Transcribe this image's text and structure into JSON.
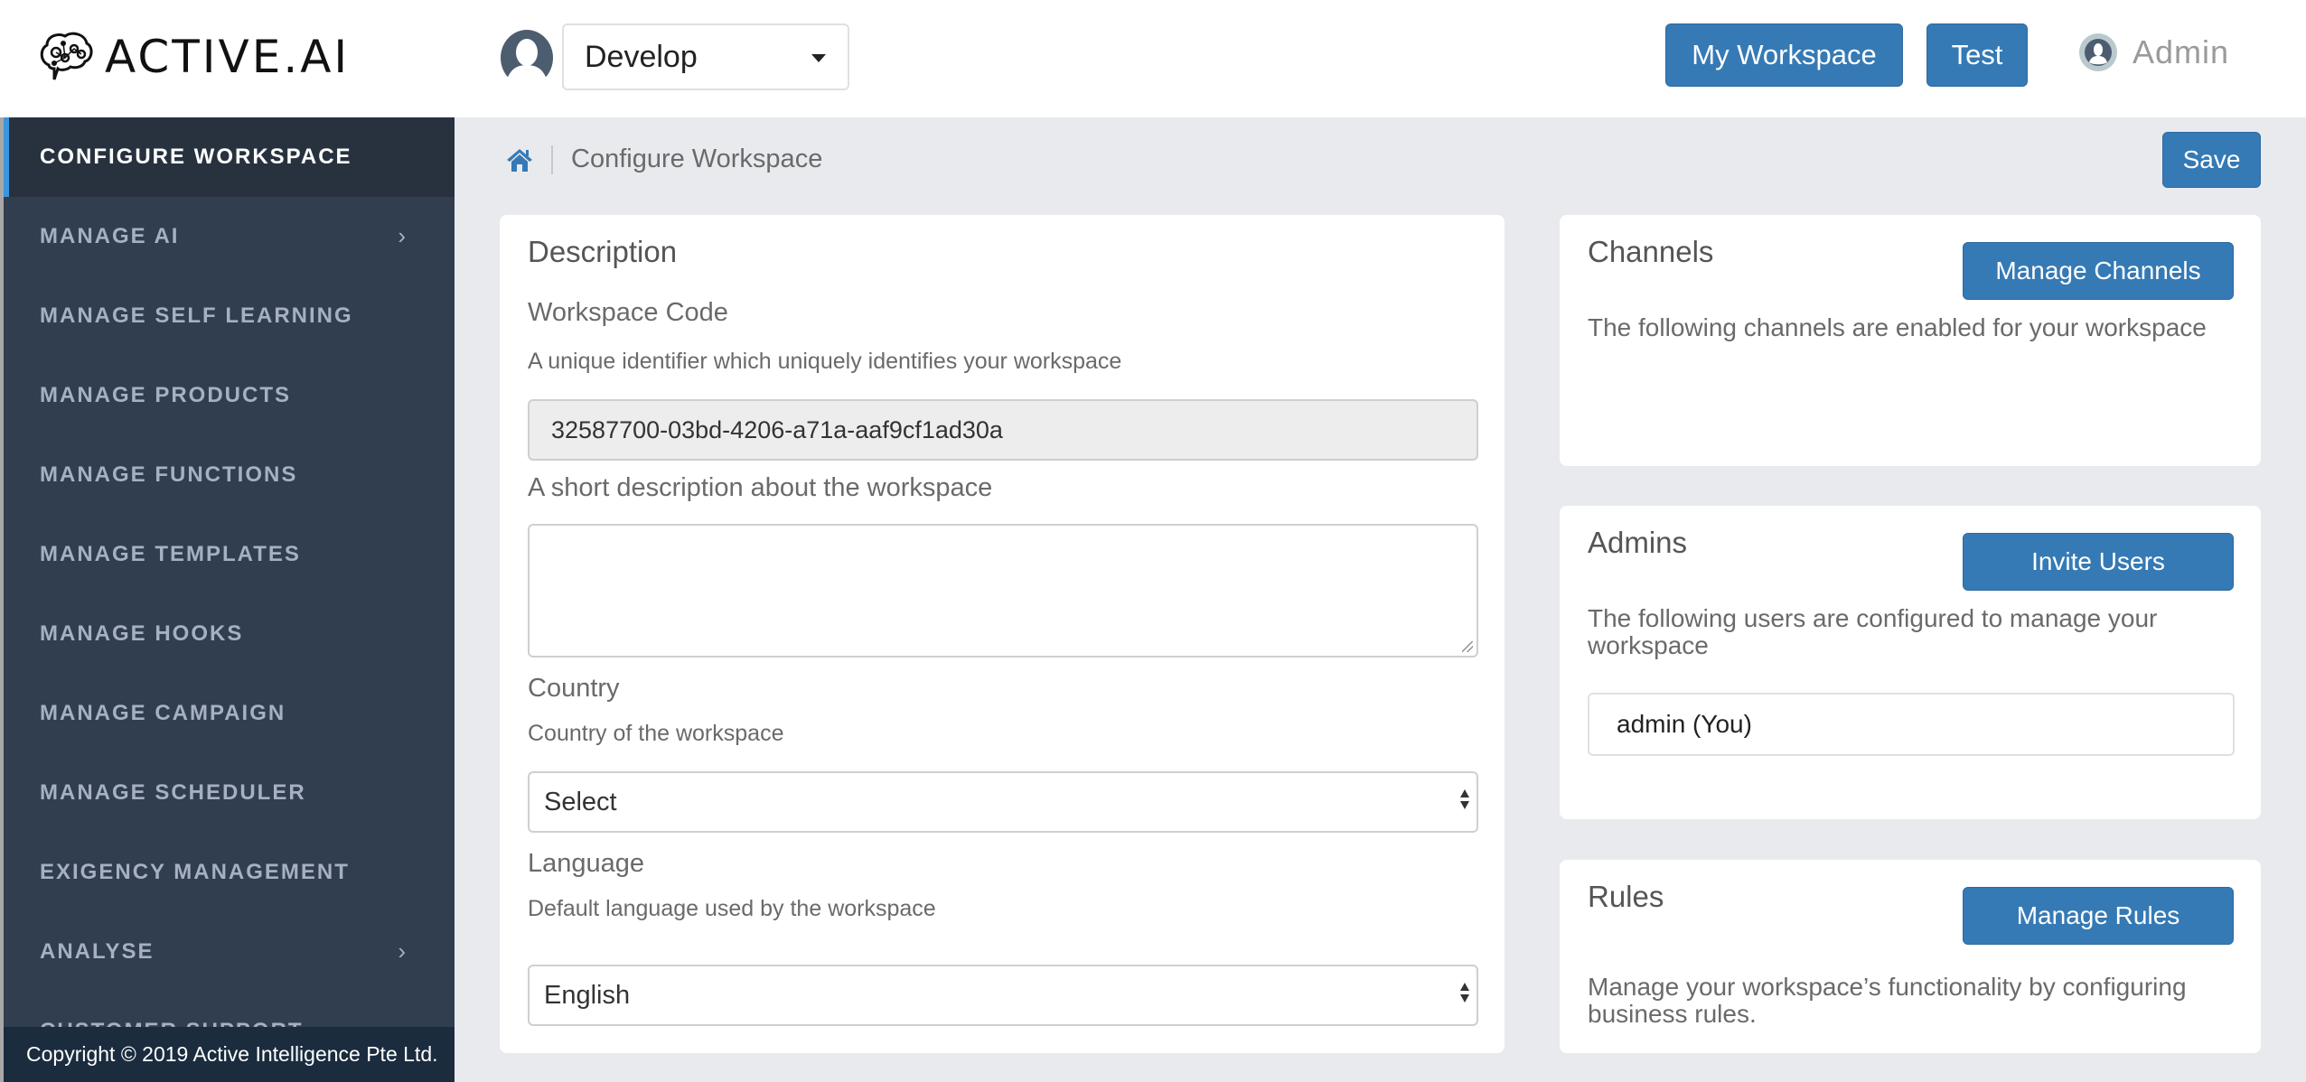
{
  "header": {
    "brand": "ACTIVE.AI",
    "workspace_selector": {
      "selected": "Develop"
    },
    "my_workspace_label": "My Workspace",
    "test_label": "Test",
    "user_name": "Admin"
  },
  "sidebar": {
    "items": [
      {
        "label": "CONFIGURE WORKSPACE",
        "active": true,
        "has_submenu": false
      },
      {
        "label": "MANAGE AI",
        "active": false,
        "has_submenu": true
      },
      {
        "label": "MANAGE SELF LEARNING",
        "active": false,
        "has_submenu": false
      },
      {
        "label": "MANAGE PRODUCTS",
        "active": false,
        "has_submenu": false
      },
      {
        "label": "MANAGE FUNCTIONS",
        "active": false,
        "has_submenu": false
      },
      {
        "label": "MANAGE TEMPLATES",
        "active": false,
        "has_submenu": false
      },
      {
        "label": "MANAGE HOOKS",
        "active": false,
        "has_submenu": false
      },
      {
        "label": "MANAGE CAMPAIGN",
        "active": false,
        "has_submenu": false
      },
      {
        "label": "MANAGE SCHEDULER",
        "active": false,
        "has_submenu": false
      },
      {
        "label": "EXIGENCY MANAGEMENT",
        "active": false,
        "has_submenu": false
      },
      {
        "label": "ANALYSE",
        "active": false,
        "has_submenu": true
      },
      {
        "label": "CUSTOMER SUPPORT",
        "active": false,
        "has_submenu": false
      }
    ],
    "footer": "Copyright © 2019 Active Intelligence Pte Ltd."
  },
  "breadcrumb": {
    "home_icon": "home-icon",
    "current": "Configure Workspace"
  },
  "toolbar": {
    "save_label": "Save"
  },
  "description_card": {
    "title": "Description",
    "workspace_code": {
      "label": "Workspace Code",
      "help": "A unique identifier which uniquely identifies your workspace",
      "value": "32587700-03bd-4206-a71a-aaf9cf1ad30a"
    },
    "short_description": {
      "label": "A short description about the workspace",
      "value": ""
    },
    "country": {
      "label": "Country",
      "help": "Country of the workspace",
      "selected": "Select"
    },
    "language": {
      "label": "Language",
      "help": "Default language used by the workspace",
      "selected": "English"
    }
  },
  "channels_card": {
    "title": "Channels",
    "button": "Manage Channels",
    "text": "The following channels are enabled for your workspace"
  },
  "admins_card": {
    "title": "Admins",
    "button": "Invite Users",
    "text": "The following users are configured to manage your workspace",
    "users": [
      "admin (You)"
    ]
  },
  "rules_card": {
    "title": "Rules",
    "button": "Manage Rules",
    "text": "Manage your workspace’s functionality by configuring business rules."
  },
  "colors": {
    "primary": "#357ab5",
    "sidebar_bg": "#303e4f",
    "sidebar_active_bg": "#28323f",
    "sidebar_active_accent": "#3b96dd",
    "sidebar_footer_bg": "#1b2c3f",
    "page_bg": "#e9eaee"
  }
}
